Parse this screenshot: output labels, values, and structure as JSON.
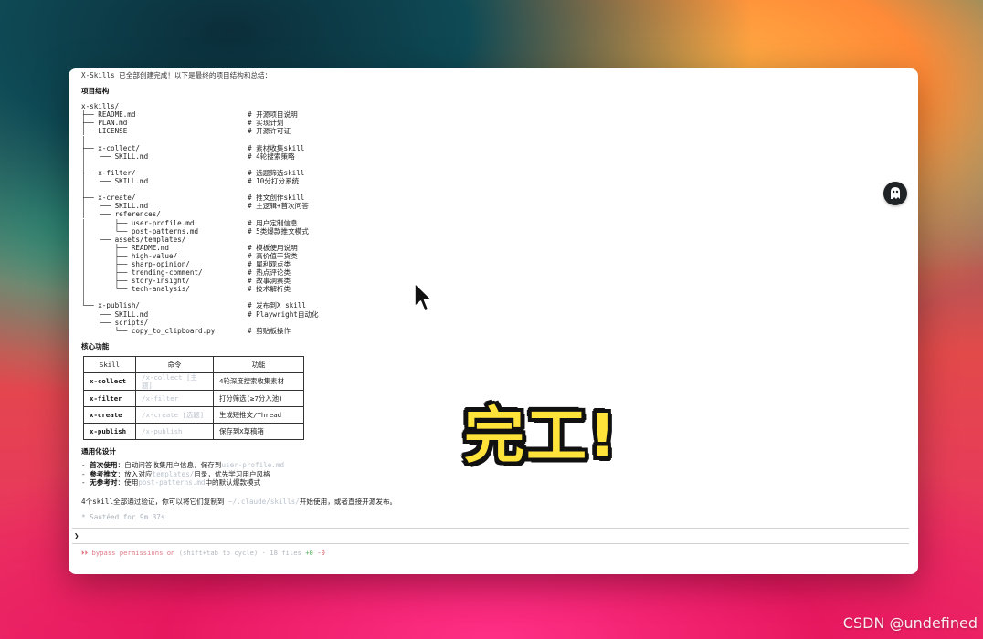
{
  "terminal": {
    "intro": "X-Skills 已全部创建完成！以下是最终的项目结构和总结：",
    "structure_heading": "项目结构",
    "tree": [
      {
        "path": "x-skills/",
        "comment": ""
      },
      {
        "path": "├── README.md",
        "comment": "# 开源项目说明"
      },
      {
        "path": "├── PLAN.md",
        "comment": "# 实现计划"
      },
      {
        "path": "├── LICENSE",
        "comment": "# 开源许可证"
      },
      {
        "path": "│",
        "comment": ""
      },
      {
        "path": "├── x-collect/",
        "comment": "# 素材收集skill"
      },
      {
        "path": "│   └── SKILL.md",
        "comment": "# 4轮搜索策略"
      },
      {
        "path": "│",
        "comment": ""
      },
      {
        "path": "├── x-filter/",
        "comment": "# 选题筛选skill"
      },
      {
        "path": "│   └── SKILL.md",
        "comment": "# 10分打分系统"
      },
      {
        "path": "│",
        "comment": ""
      },
      {
        "path": "├── x-create/",
        "comment": "# 推文创作skill"
      },
      {
        "path": "│   ├── SKILL.md",
        "comment": "# 主逻辑+首次问答"
      },
      {
        "path": "│   ├── references/",
        "comment": ""
      },
      {
        "path": "│   │   ├── user-profile.md",
        "comment": "# 用户定制信息"
      },
      {
        "path": "│   │   └── post-patterns.md",
        "comment": "# 5类爆款推文模式"
      },
      {
        "path": "│   └── assets/templates/",
        "comment": ""
      },
      {
        "path": "│       ├── README.md",
        "comment": "# 模板使用说明"
      },
      {
        "path": "│       ├── high-value/",
        "comment": "# 高价值干货类"
      },
      {
        "path": "│       ├── sharp-opinion/",
        "comment": "# 犀利观点类"
      },
      {
        "path": "│       ├── trending-comment/",
        "comment": "# 热点评论类"
      },
      {
        "path": "│       ├── story-insight/",
        "comment": "# 故事洞察类"
      },
      {
        "path": "│       └── tech-analysis/",
        "comment": "# 技术解析类"
      },
      {
        "path": "│",
        "comment": ""
      },
      {
        "path": "└── x-publish/",
        "comment": "# 发布到X skill"
      },
      {
        "path": "    ├── SKILL.md",
        "comment": "# Playwright自动化"
      },
      {
        "path": "    └── scripts/",
        "comment": ""
      },
      {
        "path": "        └── copy_to_clipboard.py",
        "comment": "# 剪贴板操作"
      }
    ],
    "features_heading": "核心功能",
    "table": {
      "headers": [
        "Skill",
        "命令",
        "功能"
      ],
      "rows": [
        {
          "skill": "x-collect",
          "command": "/x-collect [主题]",
          "function": "4轮深度搜索收集素材"
        },
        {
          "skill": "x-filter",
          "command": "/x-filter",
          "function": "打分筛选(≥7分入池)"
        },
        {
          "skill": "x-create",
          "command": "/x-create [选题]",
          "function": "生成短推文/Thread"
        },
        {
          "skill": "x-publish",
          "command": "/x-publish",
          "function": "保存到X草稿箱"
        }
      ]
    },
    "design_heading": "通用化设计",
    "design_items": [
      {
        "label": "首次使用",
        "pre": "：自动问答收集用户信息，保存到",
        "code": "user-profile.md",
        "post": ""
      },
      {
        "label": "参考推文",
        "pre": "：放入对应",
        "code": "templates/",
        "post": "目录，优先学习用户风格"
      },
      {
        "label": "无参考时",
        "pre": "：使用",
        "code": "post-patterns.md",
        "post": "中的默认爆款模式"
      }
    ],
    "summary_pre": "4个skill全部通过验证，你可以将它们复制到 ",
    "summary_code": "~/.claude/skills/",
    "summary_post": "开始使用，或者直接开源发布。",
    "cooked": "* Sautéed for 9m 37s",
    "prompt_symbol": "❯",
    "status": {
      "bypass": "⏵⏵ bypass permissions on",
      "hint": " (shift+tab to cycle) · 18 files ",
      "additions": "+0",
      "deletions": "-0"
    }
  },
  "overlay": {
    "done_text": "完工!",
    "watermark": "CSDN @undefined"
  }
}
